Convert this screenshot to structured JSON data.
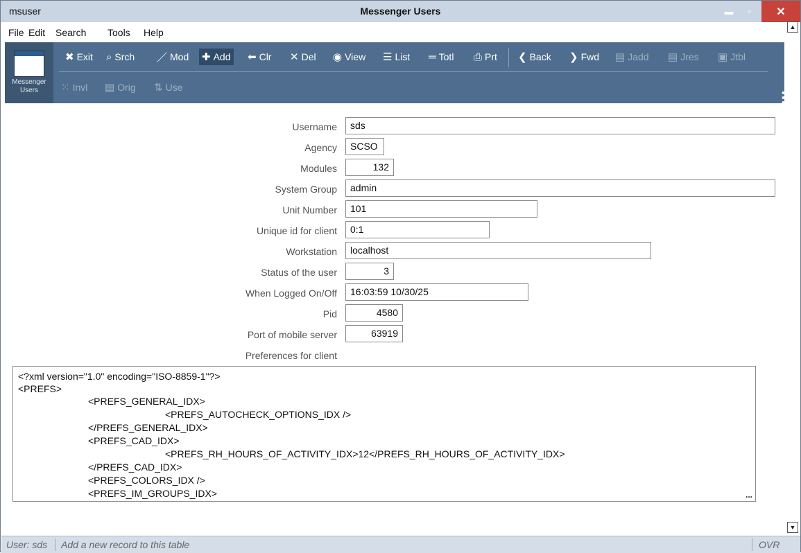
{
  "titlebar": {
    "app_name": "msuser",
    "title": "Messenger Users",
    "minimize": "▬",
    "maximize": "▫",
    "close": "✕"
  },
  "menu": [
    "File",
    "Edit",
    "Search",
    "Tools",
    "Help"
  ],
  "toolbar": {
    "module_label_1": "Messenger",
    "module_label_2": "Users",
    "buttons": [
      {
        "label": "Exit",
        "icon": "✖"
      },
      {
        "label": "Srch",
        "icon": "⌕"
      },
      {
        "label": "Mod",
        "icon": "／"
      },
      {
        "label": "Add",
        "icon": "✚"
      },
      {
        "label": "Clr",
        "icon": "⬅"
      },
      {
        "label": "Del",
        "icon": "✕"
      },
      {
        "label": "View",
        "icon": "◉"
      },
      {
        "label": "List",
        "icon": "☰"
      },
      {
        "label": "Totl",
        "icon": "═"
      },
      {
        "label": "Prt",
        "icon": "⎙"
      },
      {
        "label": "Back",
        "icon": "❮"
      },
      {
        "label": "Fwd",
        "icon": "❯"
      },
      {
        "label": "Jadd",
        "icon": "▤"
      },
      {
        "label": "Jres",
        "icon": "▤"
      },
      {
        "label": "Jtbl",
        "icon": "▣"
      },
      {
        "label": "Invl",
        "icon": "⁙"
      },
      {
        "label": "Orig",
        "icon": "▤"
      },
      {
        "label": "Use",
        "icon": "⇅"
      }
    ],
    "more_icon": "⋮"
  },
  "form": {
    "username": {
      "label": "Username",
      "value": "sds"
    },
    "agency": {
      "label": "Agency",
      "value": "SCSO"
    },
    "modules": {
      "label": "Modules",
      "value": "132"
    },
    "system_group": {
      "label": "System Group",
      "value": "admin"
    },
    "unit_number": {
      "label": "Unit Number",
      "value": "101"
    },
    "unique_id": {
      "label": "Unique id for client",
      "value": "0:1"
    },
    "workstation": {
      "label": "Workstation",
      "value": "localhost"
    },
    "status": {
      "label": "Status of the user",
      "value": "3"
    },
    "when_logged": {
      "label": "When Logged On/Off",
      "value": "16:03:59 10/30/25"
    },
    "pid": {
      "label": "Pid",
      "value": "4580"
    },
    "port": {
      "label": "Port of mobile server",
      "value": "63919"
    },
    "prefs_label": "Preferences for client"
  },
  "prefs_lines": [
    "<?xml version=\"1.0\" encoding=\"ISO-8859-1\"?>",
    "<PREFS>",
    "<PREFS_GENERAL_IDX>",
    "<PREFS_AUTOCHECK_OPTIONS_IDX />",
    "</PREFS_GENERAL_IDX>",
    "<PREFS_CAD_IDX>",
    "<PREFS_RH_HOURS_OF_ACTIVITY_IDX>12</PREFS_RH_HOURS_OF_ACTIVITY_IDX>",
    "</PREFS_CAD_IDX>",
    "<PREFS_COLORS_IDX />",
    "<PREFS_IM_GROUPS_IDX>"
  ],
  "prefs_ellipsis": "...",
  "statusbar": {
    "user": "User: sds",
    "message": "Add a new record to this table",
    "mode": "OVR"
  }
}
